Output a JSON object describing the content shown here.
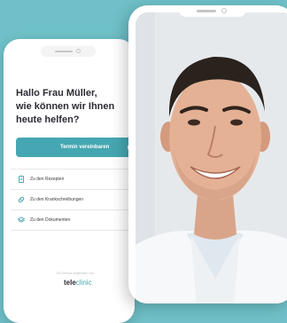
{
  "greeting": {
    "line1": "Hallo Frau Müller,",
    "line2": "wie können wir Ihnen",
    "line3": "heute helfen?"
  },
  "appointment_button": {
    "label": "Termin vereinbaren",
    "icon": "clock-icon"
  },
  "menu": [
    {
      "label": "Zu den Rezepten",
      "icon": "document-icon"
    },
    {
      "label": "Zu den Krankschreibungen",
      "icon": "pill-icon"
    },
    {
      "label": "Zu den Dokumenten",
      "icon": "layers-icon"
    }
  ],
  "brand": {
    "caption": "Ein Service angeboten von",
    "name_part1": "tele",
    "name_part2": "clinic"
  },
  "colors": {
    "background": "#6fc0c8",
    "accent": "#45a7b1",
    "text_dark": "#2d2a34"
  }
}
